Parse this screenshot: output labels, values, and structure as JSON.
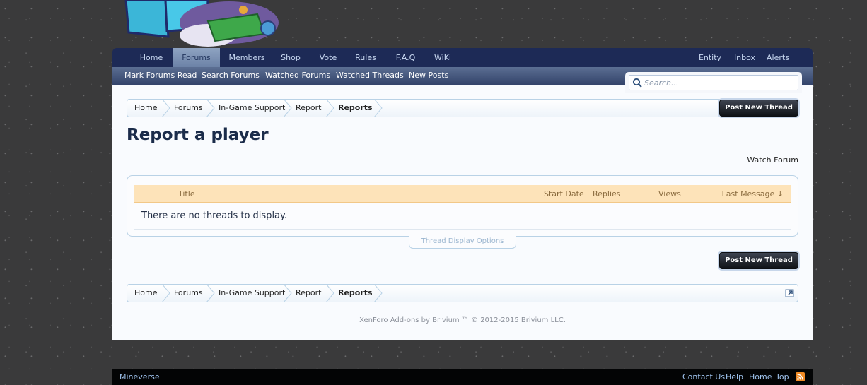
{
  "nav": {
    "tabs": [
      {
        "label": "Home"
      },
      {
        "label": "Forums"
      },
      {
        "label": "Members"
      },
      {
        "label": "Shop"
      },
      {
        "label": "Vote"
      },
      {
        "label": "Rules"
      },
      {
        "label": "F.A.Q"
      },
      {
        "label": "WiKi"
      }
    ],
    "right": [
      {
        "label": "Entity"
      },
      {
        "label": "Inbox"
      },
      {
        "label": "Alerts"
      }
    ],
    "active_tab": "Forums"
  },
  "subnav": {
    "links": [
      {
        "label": "Mark Forums Read"
      },
      {
        "label": "Search Forums"
      },
      {
        "label": "Watched Forums"
      },
      {
        "label": "Watched Threads"
      },
      {
        "label": "New Posts"
      }
    ]
  },
  "search": {
    "placeholder": "Search..."
  },
  "breadcrumb": {
    "items": [
      {
        "label": "Home"
      },
      {
        "label": "Forums"
      },
      {
        "label": "In-Game Support"
      },
      {
        "label": "Report"
      },
      {
        "label": "Reports"
      }
    ]
  },
  "page": {
    "title": "Report a player",
    "post_button": "Post New Thread",
    "watch_forum": "Watch Forum"
  },
  "threads": {
    "columns": {
      "title": "Title",
      "start_date": "Start Date",
      "replies": "Replies",
      "views": "Views",
      "last_message": "Last Message ↓"
    },
    "empty_message": "There are no threads to display.",
    "display_options": "Thread Display Options"
  },
  "copyright": "XenForo Add-ons by Brivium ™ © 2012-2015 Brivium LLC.",
  "footer": {
    "brand": "Mineverse",
    "links": [
      {
        "label": "Contact Us"
      },
      {
        "label": "Help"
      },
      {
        "label": "Home"
      },
      {
        "label": "Top"
      }
    ]
  },
  "colors": {
    "nav_bg": "#1d2a56",
    "accent_header": "#fde3b9",
    "button_bg": "#101317",
    "rss": "#f08a24"
  }
}
